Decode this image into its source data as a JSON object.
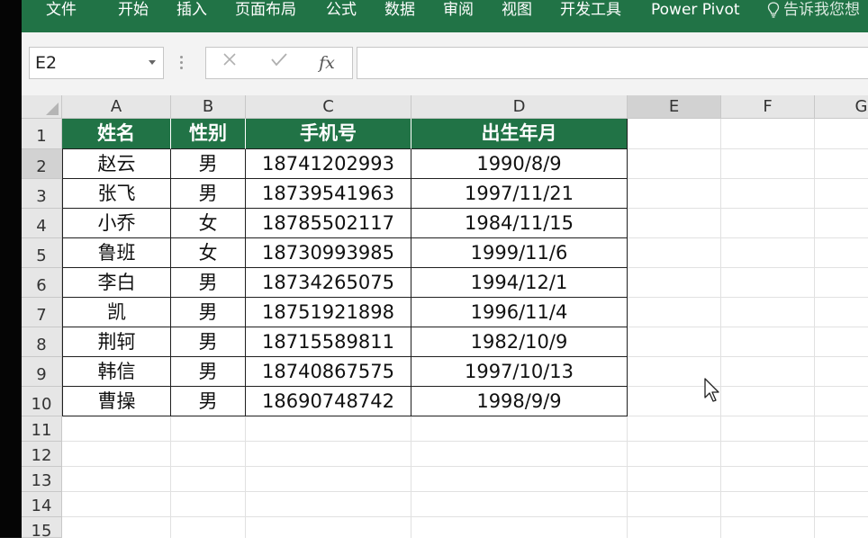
{
  "ribbon": {
    "tabs": [
      "文件",
      "开始",
      "插入",
      "页面布局",
      "公式",
      "数据",
      "审阅",
      "视图",
      "开发工具",
      "Power Pivot"
    ],
    "tell_me": "告诉我您想"
  },
  "formula_bar": {
    "name_box": "E2",
    "formula": ""
  },
  "columns": [
    "A",
    "B",
    "C",
    "D",
    "E",
    "F",
    "G"
  ],
  "rows": [
    "1",
    "2",
    "3",
    "4",
    "5",
    "6",
    "7",
    "8",
    "9",
    "10",
    "11",
    "12",
    "13",
    "14",
    "15"
  ],
  "table": {
    "headers": [
      "姓名",
      "性别",
      "手机号",
      "出生年月"
    ],
    "rows": [
      [
        "赵云",
        "男",
        "18741202993",
        "1990/8/9"
      ],
      [
        "张飞",
        "男",
        "18739541963",
        "1997/11/21"
      ],
      [
        "小乔",
        "女",
        "18785502117",
        "1984/11/15"
      ],
      [
        "鲁班",
        "女",
        "18730993985",
        "1999/11/6"
      ],
      [
        "李白",
        "男",
        "18734265075",
        "1994/12/1"
      ],
      [
        "凯",
        "男",
        "18751921898",
        "1996/11/4"
      ],
      [
        "荆轲",
        "男",
        "18715589811",
        "1982/10/9"
      ],
      [
        "韩信",
        "男",
        "18740867575",
        "1997/10/13"
      ],
      [
        "曹操",
        "男",
        "18690748742",
        "1998/9/9"
      ]
    ]
  },
  "colors": {
    "ribbon_green": "#217346",
    "header_fill": "#217346",
    "header_text": "#ffffff"
  }
}
